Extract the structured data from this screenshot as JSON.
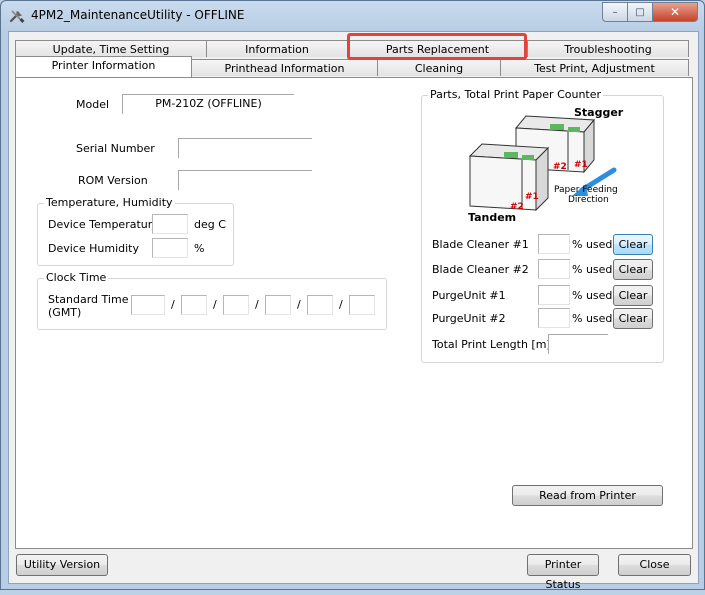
{
  "window": {
    "title": "4PM2_MaintenanceUtility - OFFLINE",
    "icon": "tools-icon",
    "controls": {
      "minimize": "–",
      "maximize": "□",
      "close": "✕"
    }
  },
  "tabs": {
    "row1": [
      "Update, Time Setting",
      "Information",
      "Parts Replacement",
      "Troubleshooting"
    ],
    "row2": [
      "Printer Information",
      "Printhead Information",
      "Cleaning",
      "Test Print, Adjustment"
    ],
    "active": "Printer Information",
    "highlighted": "Parts Replacement"
  },
  "printer_info": {
    "model_label": "Model",
    "model_value": "PM-210Z (OFFLINE)",
    "serial_label": "Serial Number",
    "serial_value": "",
    "rom_label": "ROM Version",
    "rom_value": "",
    "temp_group": {
      "title": "Temperature, Humidity",
      "device_temp_label": "Device Temperature",
      "device_temp_value": "",
      "device_temp_unit": "deg C",
      "device_humidity_label": "Device Humidity",
      "device_humidity_value": "",
      "device_humidity_unit": "%"
    },
    "clock_group": {
      "title": "Clock Time",
      "std_time_label": "Standard Time",
      "std_time_label2": "(GMT)",
      "separator": "/"
    }
  },
  "parts_counter": {
    "title": "Parts, Total Print Paper Counter",
    "diagram": {
      "stagger_label": "Stagger",
      "tandem_label": "Tandem",
      "feed_label_1": "Paper Feeding",
      "feed_label_2": "Direction",
      "unit1": "#1",
      "unit2": "#2"
    },
    "rows": [
      {
        "label": "Blade Cleaner #1",
        "value": "",
        "unit": "% used",
        "button": "Clear"
      },
      {
        "label": "Blade Cleaner #2",
        "value": "",
        "unit": "% used",
        "button": "Clear"
      },
      {
        "label": "PurgeUnit #1",
        "value": "",
        "unit": "% used",
        "button": "Clear"
      },
      {
        "label": "PurgeUnit #2",
        "value": "",
        "unit": "% used",
        "button": "Clear"
      }
    ],
    "total_label": "Total Print Length [m]",
    "total_value": ""
  },
  "buttons": {
    "read_from_printer": "Read from Printer",
    "utility_version": "Utility Version",
    "printer_status": "Printer Status",
    "close": "Close"
  },
  "colors": {
    "highlight": "#e0443c",
    "arrow": "#2d8ee0",
    "unit_label": "#cc0000"
  }
}
